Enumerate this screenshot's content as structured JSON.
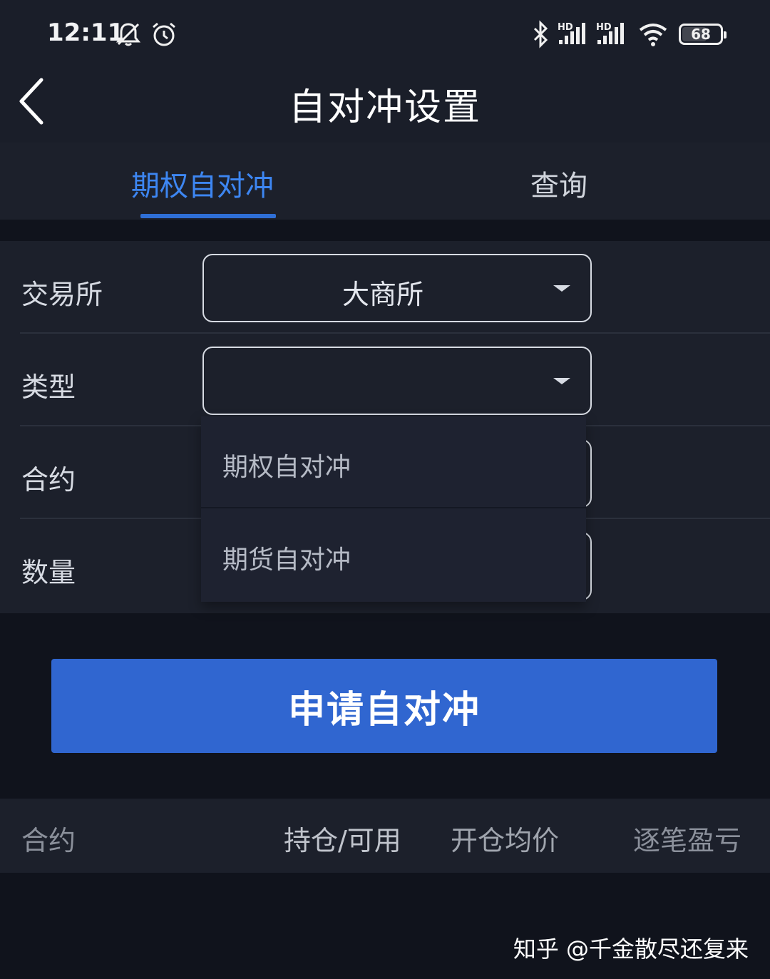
{
  "status_bar": {
    "time": "12:11",
    "battery": "68",
    "battery_level_percent": 68,
    "icons": [
      "bell-muted-icon",
      "alarm-icon",
      "bluetooth-icon",
      "signal-hd-icon",
      "signal-hd-icon",
      "wifi-icon",
      "battery-icon"
    ],
    "signal_labels": [
      "HD",
      "HD"
    ]
  },
  "nav": {
    "title": "自对冲设置",
    "back_icon": "chevron-left-icon"
  },
  "tabs": [
    {
      "label": "期权自对冲",
      "active": true
    },
    {
      "label": "查询",
      "active": false
    }
  ],
  "form": {
    "exchange": {
      "label": "交易所",
      "value": "大商所"
    },
    "type": {
      "label": "类型",
      "value": ""
    },
    "contract": {
      "label": "合约"
    },
    "quantity": {
      "label": "数量"
    }
  },
  "dropdown": {
    "options": [
      "期权自对冲",
      "期货自对冲"
    ]
  },
  "submit_label": "申请自对冲",
  "table": {
    "columns": [
      "合约",
      "持仓/可用",
      "开仓均价",
      "逐笔盈亏"
    ]
  },
  "watermark": "知乎 @千金散尽还复来",
  "colors": {
    "accent": "#3d86f2",
    "button": "#3066d0",
    "background": "#10131c",
    "panel": "#1c202b"
  }
}
